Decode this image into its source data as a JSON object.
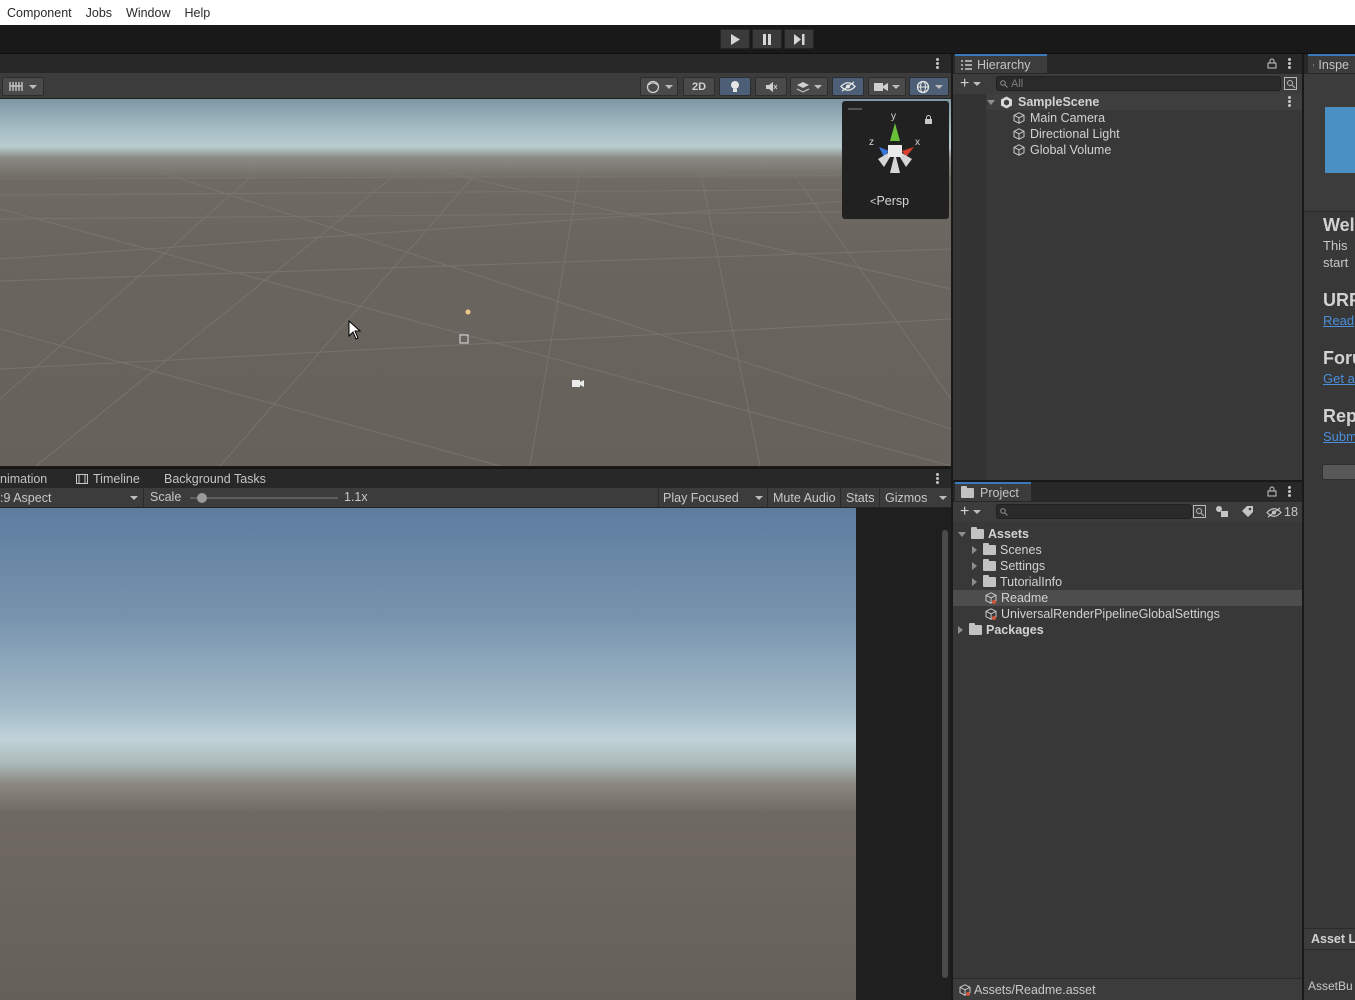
{
  "menu": [
    "Component",
    "Jobs",
    "Window",
    "Help"
  ],
  "playbar": {
    "play": "play-icon",
    "pause": "pause-icon",
    "step": "step-icon"
  },
  "scene": {
    "toolbar_2d_label": "2D",
    "gizmo_label": "Persp",
    "axes": {
      "y": "y",
      "x": "x",
      "z": "z"
    }
  },
  "bottom_tabs": [
    "nimation",
    "Timeline",
    "Background Tasks"
  ],
  "game": {
    "aspect": ":9 Aspect",
    "scale_label": "Scale",
    "scale_value": "1.1x",
    "scale_fraction": 0.08,
    "play_mode": "Play Focused",
    "mute_audio": "Mute Audio",
    "stats": "Stats",
    "gizmos": "Gizmos"
  },
  "hierarchy": {
    "tab": "Hierarchy",
    "search_placeholder": "All",
    "scene_name": "SampleScene",
    "items": [
      "Main Camera",
      "Directional Light",
      "Global Volume"
    ]
  },
  "project": {
    "tab": "Project",
    "hidden_count": "18",
    "root": "Assets",
    "folders": [
      "Scenes",
      "Settings",
      "TutorialInfo"
    ],
    "assets": [
      "Readme",
      "UniversalRenderPipelineGlobalSettings"
    ],
    "packages": "Packages",
    "footer_path": "Assets/Readme.asset"
  },
  "inspector": {
    "tab": "Inspe",
    "heading_welcome": "Wel",
    "text_line1": "This",
    "text_line2": "start",
    "heading_urp": "URP",
    "link_urp": "Read",
    "heading_forum": "Foru",
    "link_forum": "Get a",
    "heading_report": "Rep",
    "link_report": "Subm",
    "asset_label": "Asset L",
    "asset_bundle": "AssetBu"
  },
  "colors": {
    "accent": "#3a79bb",
    "selection": "#4d4d4d",
    "link": "#4c8fdd"
  }
}
